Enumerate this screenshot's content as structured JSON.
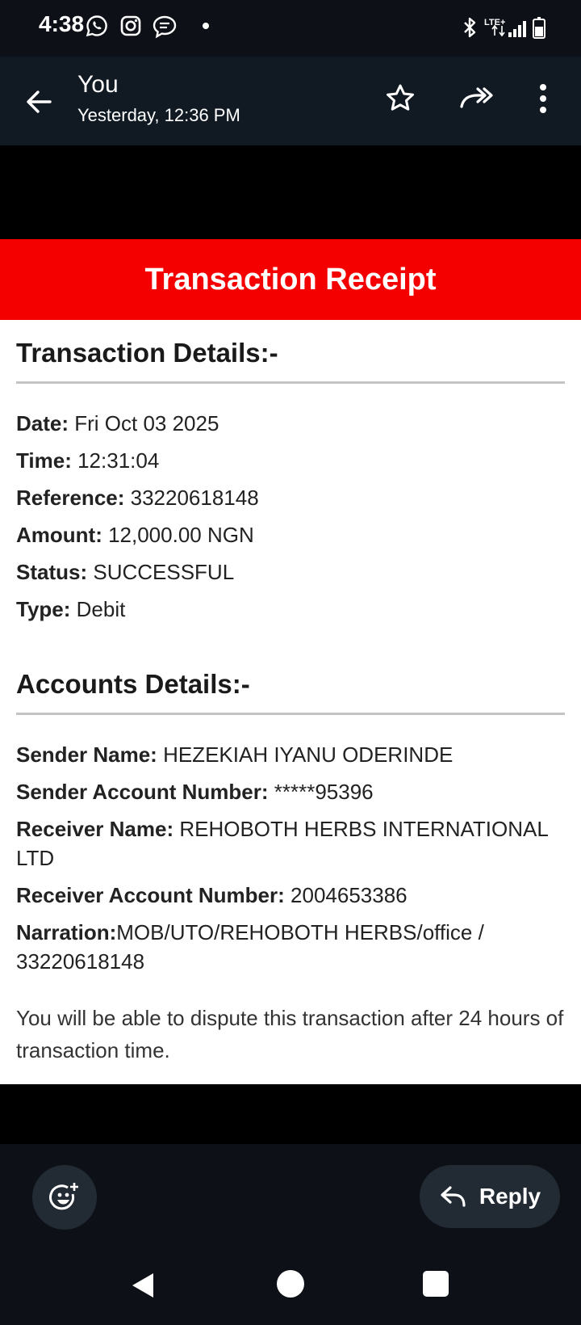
{
  "status_bar": {
    "time": "4:38",
    "icons": [
      "whatsapp-icon",
      "instagram-icon",
      "message-icon",
      "bluetooth-icon",
      "lte-icon",
      "signal-icon",
      "battery-icon"
    ],
    "network": "LTE+"
  },
  "header": {
    "sender": "You",
    "timestamp": "Yesterday, 12:36 PM"
  },
  "receipt": {
    "banner_title": "Transaction Receipt",
    "banner_color": "#f50000",
    "transaction_section_title": "Transaction Details:-",
    "transaction_fields": [
      {
        "label": "Date:",
        "value": " Fri Oct 03 2025"
      },
      {
        "label": "Time:",
        "value": " 12:31:04"
      },
      {
        "label": "Reference:",
        "value": " 33220618148"
      },
      {
        "label": "Amount:",
        "value": " 12,000.00 NGN"
      },
      {
        "label": "Status:",
        "value": " SUCCESSFUL"
      },
      {
        "label": "Type:",
        "value": " Debit"
      }
    ],
    "accounts_section_title": "Accounts Details:-",
    "account_fields": [
      {
        "label": "Sender Name:",
        "value": " HEZEKIAH IYANU ODERINDE"
      },
      {
        "label": "Sender Account Number:",
        "value": " *****95396"
      },
      {
        "label": "Receiver Name:",
        "value": " REHOBOTH HERBS INTERNATIONAL LTD"
      },
      {
        "label": "Receiver Account Number:",
        "value": " 2004653386"
      },
      {
        "label": "Narration:",
        "value": "MOB/UTO/REHOBOTH HERBS/office / 33220618148"
      }
    ],
    "dispute_note": "You will be able to dispute this transaction after 24 hours of transaction time."
  },
  "actions": {
    "reply_label": "Reply"
  }
}
